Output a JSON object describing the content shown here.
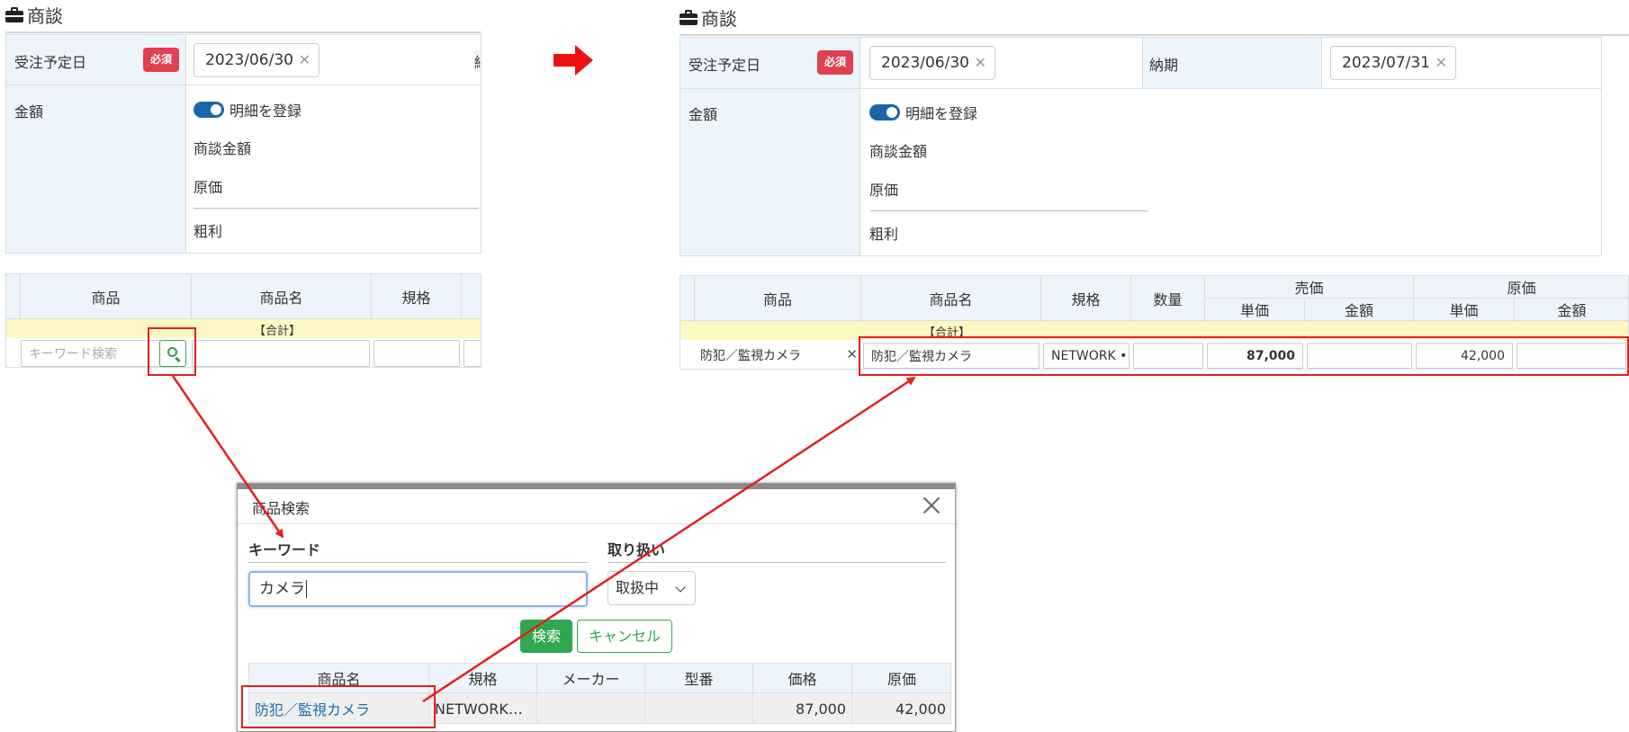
{
  "left": {
    "title": "商談",
    "order_date_label": "受注予定日",
    "required_badge": "必須",
    "order_date_value": "2023/06/30",
    "truncated_label": "納",
    "amount_label": "金額",
    "toggle_label": "明細を登録",
    "deal_amount_label": "商談金額",
    "cost_label": "原価",
    "gross_profit_label": "粗利",
    "grid_headers": [
      "商品",
      "商品名",
      "規格",
      ""
    ],
    "total_label": "【合計】",
    "keyword_placeholder": "キーワード検索"
  },
  "right": {
    "title": "商談",
    "order_date_label": "受注予定日",
    "required_badge": "必須",
    "order_date_value": "2023/06/30",
    "delivery_label": "納期",
    "delivery_value": "2023/07/31",
    "amount_label": "金額",
    "toggle_label": "明細を登録",
    "deal_amount_label": "商談金額",
    "cost_label": "原価",
    "gross_profit_label": "粗利",
    "grid_headers": {
      "product": "商品",
      "product_name": "商品名",
      "spec": "規格",
      "qty": "数量",
      "sales": "売価",
      "cost": "原価",
      "unit_price": "単価",
      "amount": "金額"
    },
    "total_label": "【合計】",
    "row": {
      "product": "防犯／監視カメラ",
      "product_name": "防犯／監視カメラ",
      "spec": "NETWORK •",
      "qty": "",
      "sales_unit": "87,000",
      "sales_amount": "",
      "cost_unit": "42,000",
      "cost_amount": ""
    }
  },
  "modal": {
    "title": "商品検索",
    "keyword_label": "キーワード",
    "keyword_value": "カメラ",
    "handling_label": "取り扱い",
    "handling_value": "取扱中",
    "search_button": "検索",
    "cancel_button": "キャンセル",
    "columns": [
      "商品名",
      "規格",
      "メーカー",
      "型番",
      "価格",
      "原価"
    ],
    "row": {
      "name": "防犯／監視カメラ",
      "spec": "NETWORK…",
      "maker": "",
      "model": "",
      "price": "87,000",
      "cost": "42,000"
    }
  },
  "colors": {
    "accent_red": "#e61e1e",
    "label_bg": "#eef4fb",
    "total_bg": "#fdf7c3",
    "green": "#2fa84f",
    "link": "#1d6fae"
  },
  "icons": {
    "title": "briefcase-icon",
    "search": "magnifier-icon",
    "arrow": "right-arrow-icon",
    "close": "close-icon",
    "clear": "clear-x-icon"
  }
}
